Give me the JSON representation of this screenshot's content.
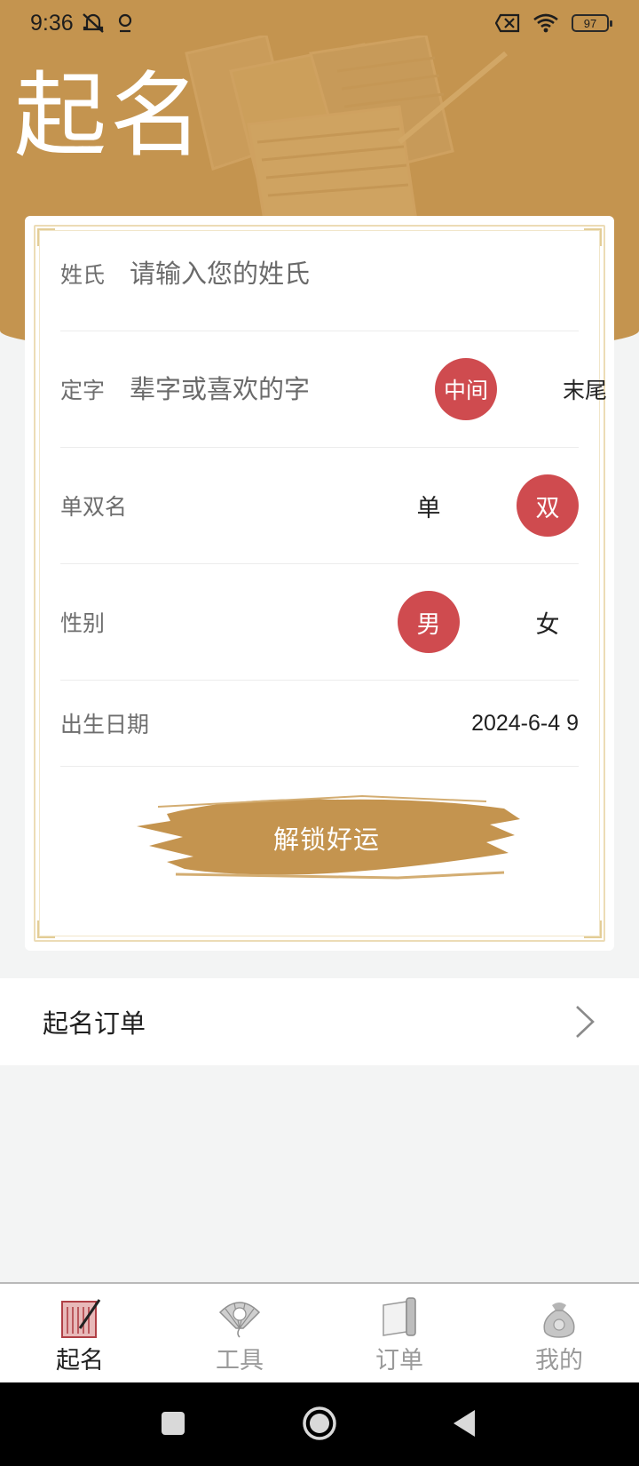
{
  "status_bar": {
    "time": "9:36",
    "battery": "97"
  },
  "page_title": "起名",
  "form": {
    "surname": {
      "label": "姓氏",
      "placeholder": "请输入您的姓氏"
    },
    "fixed_char": {
      "label": "定字",
      "placeholder": "辈字或喜欢的字",
      "options": [
        {
          "label": "中间",
          "selected": true
        },
        {
          "label": "末尾",
          "selected": false
        }
      ]
    },
    "name_length": {
      "label": "单双名",
      "options": [
        {
          "label": "单",
          "selected": false
        },
        {
          "label": "双",
          "selected": true
        }
      ]
    },
    "gender": {
      "label": "性别",
      "options": [
        {
          "label": "男",
          "selected": true
        },
        {
          "label": "女",
          "selected": false
        }
      ]
    },
    "birth_date": {
      "label": "出生日期",
      "value": "2024-6-4 9"
    },
    "submit_label": "解锁好运"
  },
  "orders_link": {
    "label": "起名订单"
  },
  "bottom_nav": [
    {
      "label": "起名",
      "icon": "naming-scroll-icon",
      "active": true
    },
    {
      "label": "工具",
      "icon": "fan-icon",
      "active": false
    },
    {
      "label": "订单",
      "icon": "scroll-icon",
      "active": false
    },
    {
      "label": "我的",
      "icon": "money-bag-icon",
      "active": false
    }
  ],
  "colors": {
    "header": "#c4944f",
    "accent_red": "#cf4b4f",
    "button_brush": "#c4944f",
    "background": "#f3f4f4"
  }
}
